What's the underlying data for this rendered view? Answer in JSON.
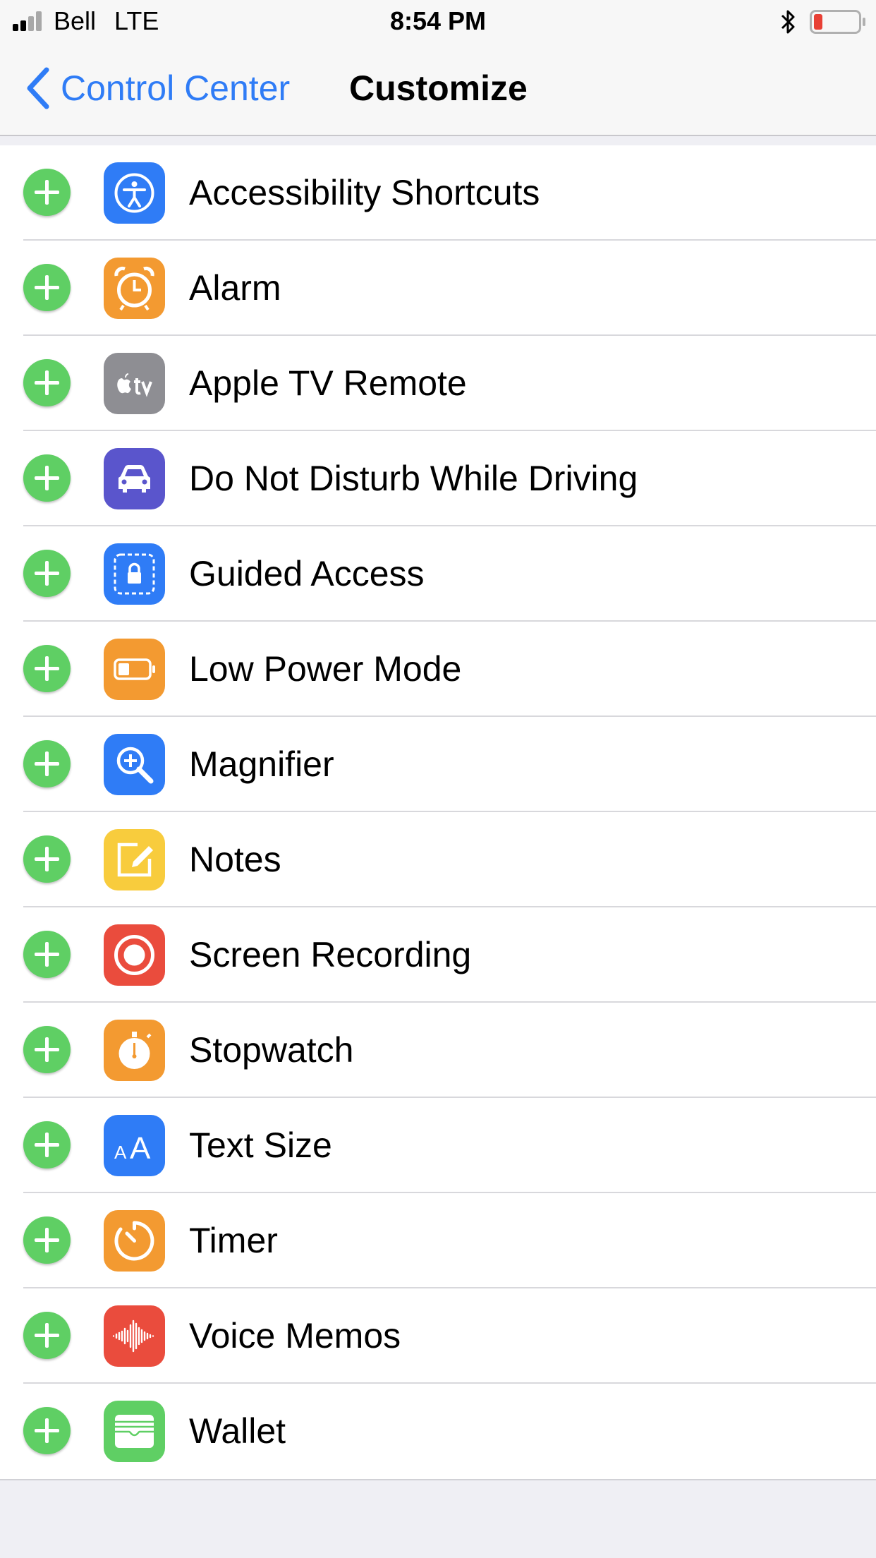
{
  "status_bar": {
    "carrier": "Bell",
    "network": "LTE",
    "time": "8:54 PM",
    "battery_color": "#e84035"
  },
  "nav": {
    "back_label": "Control Center",
    "title": "Customize",
    "accent_color": "#2f7cf6"
  },
  "items": [
    {
      "label": "Accessibility Shortcuts",
      "icon": "accessibility-icon",
      "color": "#2f7cf6"
    },
    {
      "label": "Alarm",
      "icon": "alarm-clock-icon",
      "color": "#f39a31"
    },
    {
      "label": "Apple TV Remote",
      "icon": "apple-tv-icon",
      "color": "#8e8e93"
    },
    {
      "label": "Do Not Disturb While Driving",
      "icon": "car-icon",
      "color": "#5a55cc"
    },
    {
      "label": "Guided Access",
      "icon": "lock-icon",
      "color": "#2f7cf6"
    },
    {
      "label": "Low Power Mode",
      "icon": "battery-icon",
      "color": "#f39a31"
    },
    {
      "label": "Magnifier",
      "icon": "magnifier-icon",
      "color": "#2f7cf6"
    },
    {
      "label": "Notes",
      "icon": "notes-icon",
      "color": "#f8cc3d"
    },
    {
      "label": "Screen Recording",
      "icon": "record-icon",
      "color": "#ea4c3d"
    },
    {
      "label": "Stopwatch",
      "icon": "stopwatch-icon",
      "color": "#f39a31"
    },
    {
      "label": "Text Size",
      "icon": "text-size-icon",
      "color": "#2f7cf6"
    },
    {
      "label": "Timer",
      "icon": "timer-icon",
      "color": "#f39a31"
    },
    {
      "label": "Voice Memos",
      "icon": "waveform-icon",
      "color": "#ea4c3d"
    },
    {
      "label": "Wallet",
      "icon": "wallet-icon",
      "color": "#5fcf64"
    }
  ],
  "add_button_color": "#5fcf64"
}
